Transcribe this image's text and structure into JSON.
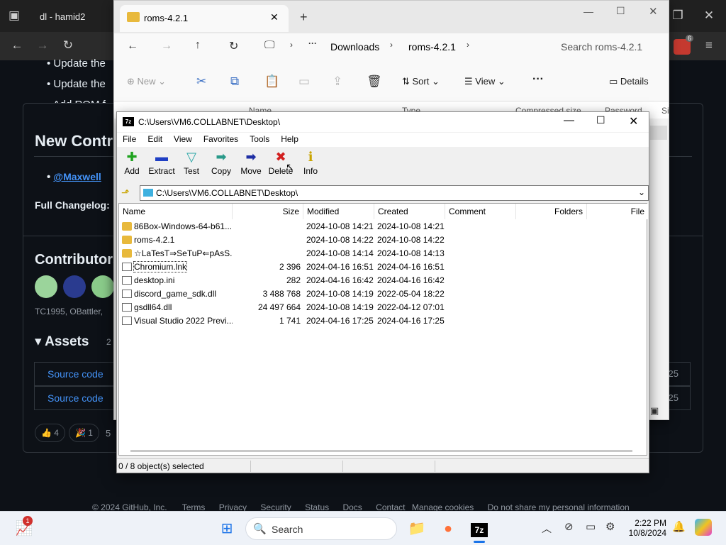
{
  "browser": {
    "tab_title": "dl - hamid2",
    "badge_count": "6",
    "page": {
      "bullets": [
        "Update the",
        "Update the",
        "Add ROM f"
      ],
      "new_contributors_heading": "New Contr",
      "contributor_handle": "@Maxwell",
      "full_changelog": "Full Changelog:",
      "contributors_heading": "Contributors",
      "contributors_text": "TC1995, OBattler,",
      "assets_heading": "Assets",
      "assets_count": "2",
      "asset_rows": [
        {
          "label": "Source code",
          "right": "25"
        },
        {
          "label": "Source code",
          "right": "25"
        }
      ],
      "reactions": [
        {
          "emoji": "👍",
          "count": "4"
        },
        {
          "emoji": "🎉",
          "count": "1"
        }
      ],
      "reaction_people": "5",
      "footer": [
        "© 2024 GitHub, Inc.",
        "Terms",
        "Privacy",
        "Security",
        "Status",
        "Docs",
        "Contact",
        "Manage cookies",
        "Do not share my personal information"
      ]
    }
  },
  "explorer": {
    "tab_title": "roms-4.2.1",
    "breadcrumb": [
      "Downloads",
      "roms-4.2.1"
    ],
    "search_placeholder": "Search roms-4.2.1",
    "commands": {
      "new": "New",
      "sort": "Sort",
      "view": "View",
      "details": "Details"
    },
    "columns": [
      "Name",
      "Type",
      "Compressed size",
      "Password",
      "Si"
    ]
  },
  "sevenzip": {
    "title": "C:\\Users\\VM6.COLLABNET\\Desktop\\",
    "menu": [
      "File",
      "Edit",
      "View",
      "Favorites",
      "Tools",
      "Help"
    ],
    "toolbar": [
      {
        "label": "Add",
        "icon": "plus-icon",
        "color": "#1fa31f"
      },
      {
        "label": "Extract",
        "icon": "minus-icon",
        "color": "#1f3fc4"
      },
      {
        "label": "Test",
        "icon": "check-icon",
        "color": "#2aa6a6"
      },
      {
        "label": "Copy",
        "icon": "arrow-right-icon",
        "color": "#2a9a8a"
      },
      {
        "label": "Move",
        "icon": "arrow-right-icon",
        "color": "#1f2fa4"
      },
      {
        "label": "Delete",
        "icon": "x-icon",
        "color": "#d21f1f"
      },
      {
        "label": "Info",
        "icon": "info-icon",
        "color": "#c9a400"
      }
    ],
    "path": "C:\\Users\\VM6.COLLABNET\\Desktop\\",
    "columns": [
      "Name",
      "Size",
      "Modified",
      "Created",
      "Comment",
      "Folders",
      "File"
    ],
    "files": [
      {
        "name": "86Box-Windows-64-b61...",
        "size": "",
        "modified": "2024-10-08 14:21",
        "created": "2024-10-08 14:21",
        "type": "folder"
      },
      {
        "name": "roms-4.2.1",
        "size": "",
        "modified": "2024-10-08 14:22",
        "created": "2024-10-08 14:22",
        "type": "folder"
      },
      {
        "name": "☆LaTesT⇒SeTuP⇐pAsS...",
        "size": "",
        "modified": "2024-10-08 14:14",
        "created": "2024-10-08 14:13",
        "type": "folder"
      },
      {
        "name": "Chromium.lnk",
        "size": "2 396",
        "modified": "2024-04-16 16:51",
        "created": "2024-04-16 16:51",
        "type": "file"
      },
      {
        "name": "desktop.ini",
        "size": "282",
        "modified": "2024-04-16 16:42",
        "created": "2024-04-16 16:42",
        "type": "ini"
      },
      {
        "name": "discord_game_sdk.dll",
        "size": "3 488 768",
        "modified": "2024-10-08 14:19",
        "created": "2022-05-04 18:22",
        "type": "dll"
      },
      {
        "name": "gsdll64.dll",
        "size": "24 497 664",
        "modified": "2024-10-08 14:19",
        "created": "2022-04-12 07:01",
        "type": "dll"
      },
      {
        "name": "Visual Studio 2022 Previ...",
        "size": "1 741",
        "modified": "2024-04-16 17:25",
        "created": "2024-04-16 17:25",
        "type": "file"
      }
    ],
    "status": "0 / 8 object(s) selected"
  },
  "taskbar": {
    "search_label": "Search",
    "time": "2:22 PM",
    "date": "10/8/2024",
    "widget_badge": "1"
  }
}
